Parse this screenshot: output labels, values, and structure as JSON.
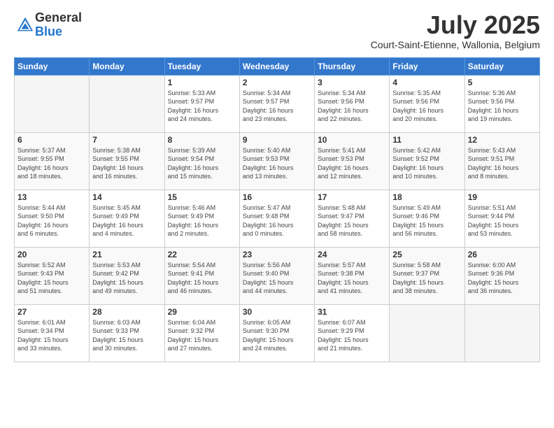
{
  "logo": {
    "general": "General",
    "blue": "Blue"
  },
  "header": {
    "month": "July 2025",
    "location": "Court-Saint-Etienne, Wallonia, Belgium"
  },
  "weekdays": [
    "Sunday",
    "Monday",
    "Tuesday",
    "Wednesday",
    "Thursday",
    "Friday",
    "Saturday"
  ],
  "weeks": [
    [
      {
        "day": "",
        "info": ""
      },
      {
        "day": "",
        "info": ""
      },
      {
        "day": "1",
        "info": "Sunrise: 5:33 AM\nSunset: 9:57 PM\nDaylight: 16 hours\nand 24 minutes."
      },
      {
        "day": "2",
        "info": "Sunrise: 5:34 AM\nSunset: 9:57 PM\nDaylight: 16 hours\nand 23 minutes."
      },
      {
        "day": "3",
        "info": "Sunrise: 5:34 AM\nSunset: 9:56 PM\nDaylight: 16 hours\nand 22 minutes."
      },
      {
        "day": "4",
        "info": "Sunrise: 5:35 AM\nSunset: 9:56 PM\nDaylight: 16 hours\nand 20 minutes."
      },
      {
        "day": "5",
        "info": "Sunrise: 5:36 AM\nSunset: 9:56 PM\nDaylight: 16 hours\nand 19 minutes."
      }
    ],
    [
      {
        "day": "6",
        "info": "Sunrise: 5:37 AM\nSunset: 9:55 PM\nDaylight: 16 hours\nand 18 minutes."
      },
      {
        "day": "7",
        "info": "Sunrise: 5:38 AM\nSunset: 9:55 PM\nDaylight: 16 hours\nand 16 minutes."
      },
      {
        "day": "8",
        "info": "Sunrise: 5:39 AM\nSunset: 9:54 PM\nDaylight: 16 hours\nand 15 minutes."
      },
      {
        "day": "9",
        "info": "Sunrise: 5:40 AM\nSunset: 9:53 PM\nDaylight: 16 hours\nand 13 minutes."
      },
      {
        "day": "10",
        "info": "Sunrise: 5:41 AM\nSunset: 9:53 PM\nDaylight: 16 hours\nand 12 minutes."
      },
      {
        "day": "11",
        "info": "Sunrise: 5:42 AM\nSunset: 9:52 PM\nDaylight: 16 hours\nand 10 minutes."
      },
      {
        "day": "12",
        "info": "Sunrise: 5:43 AM\nSunset: 9:51 PM\nDaylight: 16 hours\nand 8 minutes."
      }
    ],
    [
      {
        "day": "13",
        "info": "Sunrise: 5:44 AM\nSunset: 9:50 PM\nDaylight: 16 hours\nand 6 minutes."
      },
      {
        "day": "14",
        "info": "Sunrise: 5:45 AM\nSunset: 9:49 PM\nDaylight: 16 hours\nand 4 minutes."
      },
      {
        "day": "15",
        "info": "Sunrise: 5:46 AM\nSunset: 9:49 PM\nDaylight: 16 hours\nand 2 minutes."
      },
      {
        "day": "16",
        "info": "Sunrise: 5:47 AM\nSunset: 9:48 PM\nDaylight: 16 hours\nand 0 minutes."
      },
      {
        "day": "17",
        "info": "Sunrise: 5:48 AM\nSunset: 9:47 PM\nDaylight: 15 hours\nand 58 minutes."
      },
      {
        "day": "18",
        "info": "Sunrise: 5:49 AM\nSunset: 9:46 PM\nDaylight: 15 hours\nand 56 minutes."
      },
      {
        "day": "19",
        "info": "Sunrise: 5:51 AM\nSunset: 9:44 PM\nDaylight: 15 hours\nand 53 minutes."
      }
    ],
    [
      {
        "day": "20",
        "info": "Sunrise: 5:52 AM\nSunset: 9:43 PM\nDaylight: 15 hours\nand 51 minutes."
      },
      {
        "day": "21",
        "info": "Sunrise: 5:53 AM\nSunset: 9:42 PM\nDaylight: 15 hours\nand 49 minutes."
      },
      {
        "day": "22",
        "info": "Sunrise: 5:54 AM\nSunset: 9:41 PM\nDaylight: 15 hours\nand 46 minutes."
      },
      {
        "day": "23",
        "info": "Sunrise: 5:56 AM\nSunset: 9:40 PM\nDaylight: 15 hours\nand 44 minutes."
      },
      {
        "day": "24",
        "info": "Sunrise: 5:57 AM\nSunset: 9:38 PM\nDaylight: 15 hours\nand 41 minutes."
      },
      {
        "day": "25",
        "info": "Sunrise: 5:58 AM\nSunset: 9:37 PM\nDaylight: 15 hours\nand 38 minutes."
      },
      {
        "day": "26",
        "info": "Sunrise: 6:00 AM\nSunset: 9:36 PM\nDaylight: 15 hours\nand 36 minutes."
      }
    ],
    [
      {
        "day": "27",
        "info": "Sunrise: 6:01 AM\nSunset: 9:34 PM\nDaylight: 15 hours\nand 33 minutes."
      },
      {
        "day": "28",
        "info": "Sunrise: 6:03 AM\nSunset: 9:33 PM\nDaylight: 15 hours\nand 30 minutes."
      },
      {
        "day": "29",
        "info": "Sunrise: 6:04 AM\nSunset: 9:32 PM\nDaylight: 15 hours\nand 27 minutes."
      },
      {
        "day": "30",
        "info": "Sunrise: 6:05 AM\nSunset: 9:30 PM\nDaylight: 15 hours\nand 24 minutes."
      },
      {
        "day": "31",
        "info": "Sunrise: 6:07 AM\nSunset: 9:29 PM\nDaylight: 15 hours\nand 21 minutes."
      },
      {
        "day": "",
        "info": ""
      },
      {
        "day": "",
        "info": ""
      }
    ]
  ]
}
